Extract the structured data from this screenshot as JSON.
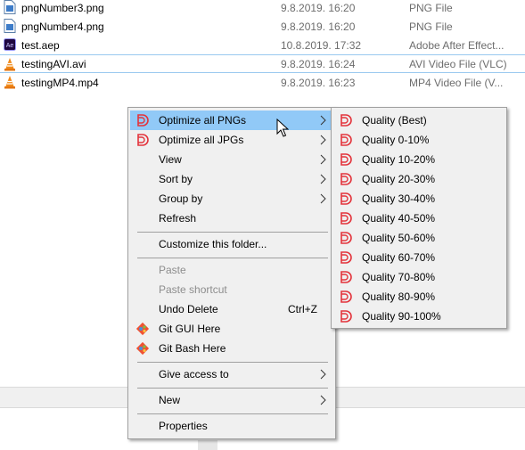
{
  "files": [
    {
      "name": "pngNumber3.png",
      "date": "9.8.2019. 16:20",
      "type": "PNG File",
      "icon": "png-file-icon"
    },
    {
      "name": "pngNumber4.png",
      "date": "9.8.2019. 16:20",
      "type": "PNG File",
      "icon": "png-file-icon"
    },
    {
      "name": "test.aep",
      "date": "10.8.2019. 17:32",
      "type": "Adobe After Effect...",
      "icon": "after-effects-file-icon"
    },
    {
      "name": "testingAVI.avi",
      "date": "9.8.2019. 16:24",
      "type": "AVI Video File (VLC)",
      "icon": "vlc-file-icon"
    },
    {
      "name": "testingMP4.mp4",
      "date": "9.8.2019. 16:23",
      "type": "MP4 Video File (V...",
      "icon": "vlc-file-icon"
    }
  ],
  "context_menu": {
    "items": [
      {
        "label": "Optimize all PNGs",
        "icon": "optimizer-icon",
        "submenu": true,
        "highlighted": true
      },
      {
        "label": "Optimize all JPGs",
        "icon": "optimizer-icon",
        "submenu": true
      },
      {
        "label": "View",
        "submenu": true
      },
      {
        "label": "Sort by",
        "submenu": true
      },
      {
        "label": "Group by",
        "submenu": true
      },
      {
        "label": "Refresh"
      },
      {
        "label": "Customize this folder..."
      },
      {
        "label": "Paste",
        "disabled": true
      },
      {
        "label": "Paste shortcut",
        "disabled": true
      },
      {
        "label": "Undo Delete",
        "shortcut": "Ctrl+Z"
      },
      {
        "label": "Git GUI Here",
        "icon": "git-icon"
      },
      {
        "label": "Git Bash Here",
        "icon": "git-icon"
      },
      {
        "label": "Give access to",
        "submenu": true
      },
      {
        "label": "New",
        "submenu": true
      },
      {
        "label": "Properties"
      }
    ]
  },
  "submenu": {
    "items": [
      {
        "label": "Quality (Best)"
      },
      {
        "label": "Quality 0-10%"
      },
      {
        "label": "Quality 10-20%"
      },
      {
        "label": "Quality 20-30%"
      },
      {
        "label": "Quality 30-40%"
      },
      {
        "label": "Quality 40-50%"
      },
      {
        "label": "Quality 50-60%"
      },
      {
        "label": "Quality 60-70%"
      },
      {
        "label": "Quality 70-80%"
      },
      {
        "label": "Quality 80-90%"
      },
      {
        "label": "Quality 90-100%"
      }
    ]
  },
  "colors": {
    "highlight": "#91c9f7",
    "menu_bg": "#f0f0f0",
    "optimizer_red": "#e3343c",
    "disabled_text": "#8d8d8d"
  }
}
